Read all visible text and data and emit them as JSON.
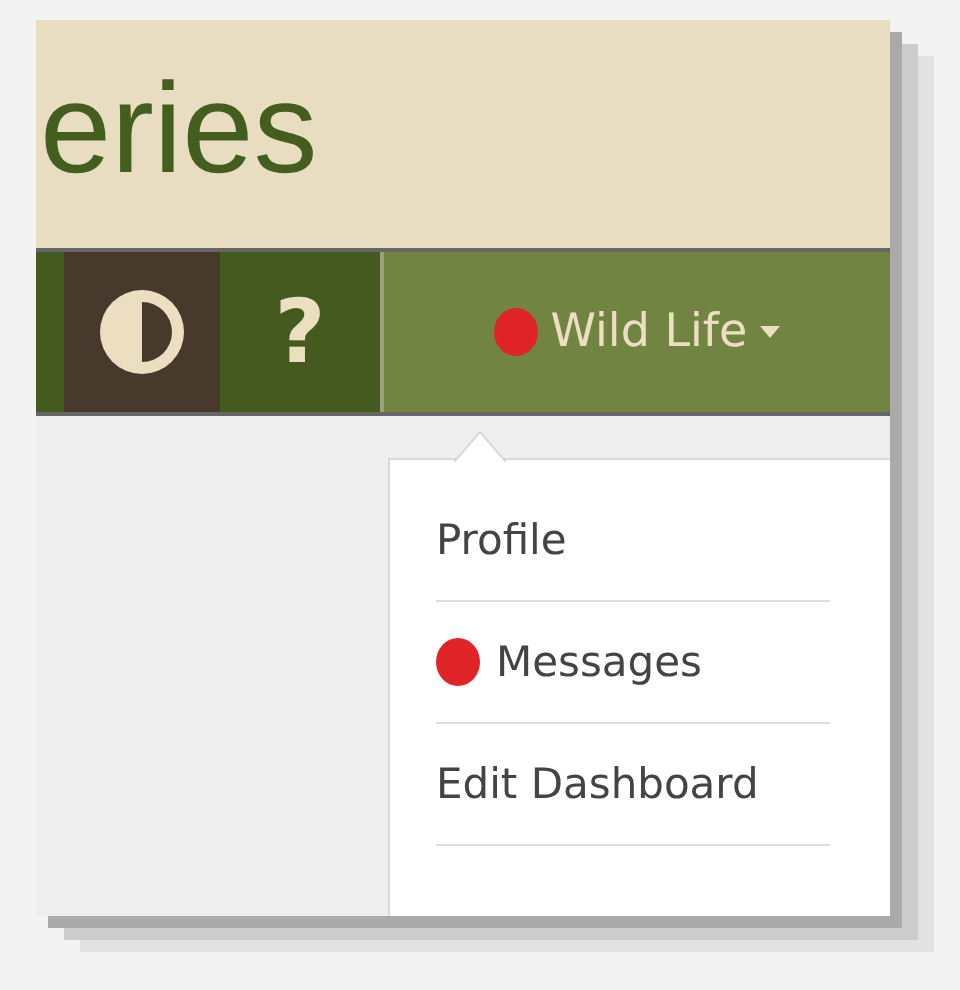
{
  "header": {
    "title": "eries"
  },
  "nav": {
    "tools": [
      {
        "kind": "contrast"
      },
      {
        "kind": "help",
        "label": "?"
      }
    ],
    "account": {
      "label": "Wild Life",
      "notification": true
    }
  },
  "menu": [
    {
      "label": "Profile",
      "notification": false
    },
    {
      "label": "Messages",
      "notification": true
    },
    {
      "label": "Edit Dashboard",
      "notification": false
    }
  ]
}
